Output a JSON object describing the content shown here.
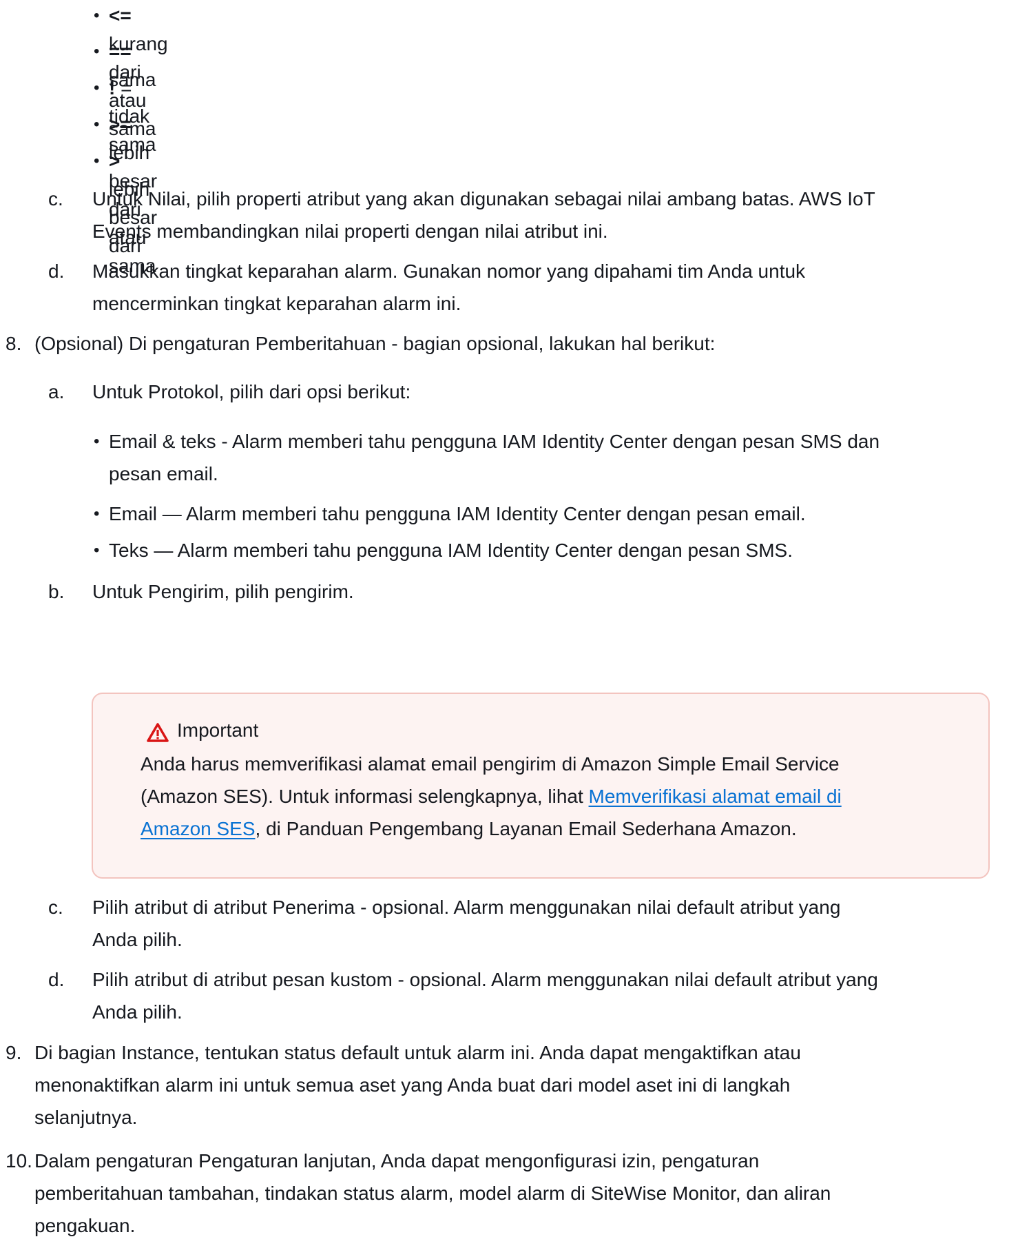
{
  "operators": [
    {
      "symbol": "<=",
      "text": " kurang dari atau sama"
    },
    {
      "symbol": "==",
      "text": " sama"
    },
    {
      "symbol": "!",
      "text": " = tidak sama"
    },
    {
      "symbol": ">=",
      "text": " lebih besar dari atau sama"
    },
    {
      "symbol": ">",
      "text": " lebih besar dari"
    }
  ],
  "step7": {
    "c": {
      "label": "c.",
      "line1": "Untuk Nilai, pilih properti atribut yang akan digunakan sebagai nilai ambang batas. AWS IoT",
      "line2": "Events membandingkan nilai properti dengan nilai atribut ini."
    },
    "d": {
      "label": "d.",
      "line1": "Masukkan tingkat keparahan alarm. Gunakan nomor yang dipahami tim Anda untuk",
      "line2": "mencerminkan tingkat keparahan alarm ini."
    }
  },
  "step8": {
    "label": "8.",
    "text": "(Opsional) Di pengaturan Pemberitahuan - bagian opsional, lakukan hal berikut:",
    "a": {
      "label": "a.",
      "text": "Untuk Protokol, pilih dari opsi berikut:"
    },
    "protocols": [
      {
        "line1": "Email & teks - Alarm memberi tahu pengguna IAM Identity Center dengan pesan SMS dan",
        "line2": "pesan email."
      },
      {
        "line1": "Email — Alarm memberi tahu pengguna IAM Identity Center dengan pesan email.",
        "line2": ""
      },
      {
        "line1": "Teks — Alarm memberi tahu pengguna IAM Identity Center dengan pesan SMS.",
        "line2": ""
      }
    ],
    "b": {
      "label": "b.",
      "text": "Untuk Pengirim, pilih pengirim."
    },
    "important": {
      "title": "Important",
      "line1": "Anda harus memverifikasi alamat email pengirim di Amazon Simple Email Service",
      "line2_prefix": "(Amazon SES). Untuk informasi selengkapnya, lihat ",
      "link_part1": "Memverifikasi alamat email di",
      "link_part2": "Amazon SES",
      "line3_suffix": ", di Panduan Pengembang Layanan Email Sederhana Amazon."
    },
    "c": {
      "label": "c.",
      "line1": "Pilih atribut di atribut Penerima - opsional. Alarm menggunakan nilai default atribut yang",
      "line2": "Anda pilih."
    },
    "d": {
      "label": "d.",
      "line1": "Pilih atribut di atribut pesan kustom - opsional. Alarm menggunakan nilai default atribut yang",
      "line2": "Anda pilih."
    }
  },
  "step9": {
    "label": "9.",
    "line1": "Di bagian Instance, tentukan status default untuk alarm ini. Anda dapat mengaktifkan atau",
    "line2": "menonaktifkan alarm ini untuk semua aset yang Anda buat dari model aset ini di langkah",
    "line3": "selanjutnya."
  },
  "step10": {
    "label": "10.",
    "line1": "Dalam pengaturan Pengaturan lanjutan, Anda dapat mengonfigurasi izin, pengaturan",
    "line2": "pemberitahuan tambahan, tindakan status alarm, model alarm di SiteWise Monitor, dan aliran",
    "line3": "pengakuan."
  },
  "colors": {
    "text": "#16191f",
    "link": "#0972d3",
    "alert_bg": "#fdf3f2",
    "alert_border": "#f3c4bf",
    "warning_icon": "#d91515"
  }
}
